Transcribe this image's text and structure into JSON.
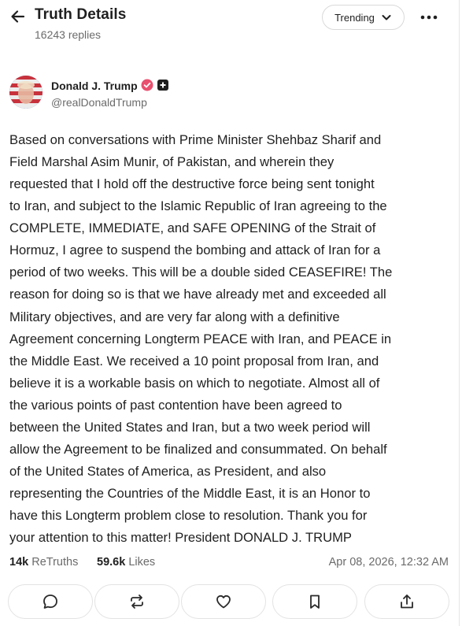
{
  "header": {
    "title": "Truth Details",
    "replies": "16243 replies",
    "sort_label": "Trending"
  },
  "author": {
    "name": "Donald J. Trump",
    "handle": "@realDonaldTrump"
  },
  "post": {
    "text": "Based on conversations with Prime Minister Shehbaz Sharif and\nField Marshal Asim Munir, of Pakistan, and wherein they\nrequested that I hold off the destructive force being sent tonight\nto Iran, and subject to the Islamic Republic of Iran agreeing to the\nCOMPLETE, IMMEDIATE, and SAFE OPENING of the Strait of\nHormuz, I agree to suspend the bombing and attack of Iran for a\nperiod of two weeks. This will be a double sided CEASEFIRE! The\nreason for doing so is that we have already met and exceeded all\nMilitary objectives, and are very far along with a definitive\nAgreement concerning Longterm PEACE with Iran, and PEACE in\nthe Middle East. We received a 10 point proposal from Iran, and\nbelieve it is a workable basis on which to negotiate. Almost all of\nthe various points of past contention have been agreed to\nbetween the United States and Iran, but a two week period will\nallow the Agreement to be finalized and consummated. On behalf\nof the United States of America, as President, and also\nrepresenting the Countries of the Middle East, it is an Honor to\nhave this Longterm problem close to resolution. Thank you for\nyour attention to this matter! President DONALD J. TRUMP"
  },
  "stats": {
    "retruths_count": "14k",
    "retruths_label": "ReTruths",
    "likes_count": "59.6k",
    "likes_label": "Likes",
    "timestamp": "Apr 08, 2026, 12:32 AM"
  },
  "actions": [
    "reply-icon",
    "retruth-icon",
    "heart-icon",
    "bookmark-icon",
    "share-icon"
  ],
  "colors": {
    "verified_badge": "#e8506e",
    "text_primary": "#1f1f1f",
    "text_secondary": "#6b6b6b",
    "border": "#e3e3e3"
  }
}
